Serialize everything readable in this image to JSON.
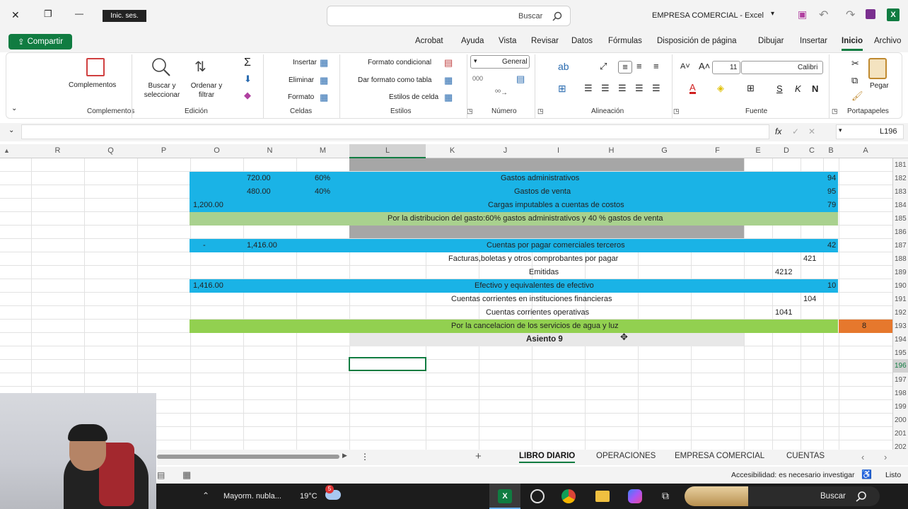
{
  "titlebar": {
    "title": "EMPRESA COMERCIAL  -  Excel",
    "search_placeholder": "Buscar",
    "signin": "Inic. ses.",
    "close": "✕",
    "restore": "❐",
    "minimize": "—"
  },
  "menu": [
    "Archivo",
    "Inicio",
    "Insertar",
    "Dibujar",
    "Disposición de página",
    "Fórmulas",
    "Datos",
    "Revisar",
    "Vista",
    "Ayuda",
    "Acrobat"
  ],
  "share_label": "Compartir",
  "ribbon": {
    "groups": {
      "portapapeles": "Portapapeles",
      "fuente": "Fuente",
      "alineacion": "Alineación",
      "numero": "Número",
      "estilos": "Estilos",
      "celdas": "Celdas",
      "edicion": "Edición",
      "complementos": "Complementos"
    },
    "pegar": "Pegar",
    "font_name": "Calibri",
    "font_size": "11",
    "number_format": "General",
    "formato_condicional": "Formato condicional",
    "dar_formato_tabla": "Dar formato como tabla",
    "estilos_celda": "Estilos de celda",
    "insertar": "Insertar",
    "eliminar": "Eliminar",
    "formato": "Formato",
    "ordenar": "Ordenar y filtrar",
    "buscar": "Buscar y seleccionar",
    "complementos_btn": "Complementos"
  },
  "formula_bar": {
    "name_box": "L196",
    "fx": "fx",
    "content": ""
  },
  "columns": [
    "A",
    "B",
    "C",
    "D",
    "E",
    "F",
    "G",
    "H",
    "I",
    "J",
    "K",
    "L",
    "M",
    "N",
    "O",
    "P",
    "Q",
    "R"
  ],
  "row_numbers": [
    "181",
    "182",
    "183",
    "184",
    "185",
    "186",
    "187",
    "188",
    "189",
    "190",
    "191",
    "192",
    "193",
    "194",
    "195",
    "196",
    "197",
    "198",
    "199",
    "200",
    "201",
    "202"
  ],
  "rows": {
    "r182": {
      "code": "94",
      "desc": "Gastos administrativos",
      "pct": "60%",
      "amount": "720.00"
    },
    "r183": {
      "code": "95",
      "desc": "Gastos de venta",
      "pct": "40%",
      "amount": "480.00"
    },
    "r184": {
      "code": "79",
      "desc": "Cargas imputables a cuentas de costos",
      "total": "1,200.00"
    },
    "r185": {
      "desc": "Por la distribucion del gasto:60% gastos administrativos y 40 % gastos de venta"
    },
    "r187": {
      "code": "42",
      "desc": "Cuentas por pagar comerciales terceros",
      "amount": "1,416.00",
      "dash": "-"
    },
    "r188": {
      "code": "421",
      "desc": "Facturas,boletas y otros comprobantes por pagar"
    },
    "r189": {
      "code": "4212",
      "desc": "Emitidas"
    },
    "r190": {
      "code": "10",
      "desc": "Efectivo y equivalentes de efectivo",
      "total": "1,416.00"
    },
    "r191": {
      "code": "104",
      "desc": "Cuentas corrientes en instituciones financieras"
    },
    "r192": {
      "code": "1041",
      "desc": "Cuentas corrientes operativas"
    },
    "r193": {
      "num": "8",
      "desc": "Por la cancelacion de los servicios de agua y luz"
    },
    "r194": {
      "desc": "Asiento 9"
    }
  },
  "sheets": [
    "CUENTAS",
    "EMPRESA COMERCIAL",
    "OPERACIONES",
    "LIBRO DIARIO"
  ],
  "active_sheet": "LIBRO DIARIO",
  "status": {
    "ready": "Listo",
    "accessibility": "Accesibilidad: es necesario investigar"
  },
  "taskbar": {
    "search": "Buscar",
    "weather_temp": "19°C",
    "weather_text": "Mayorm. nubla...",
    "badge": "5"
  },
  "colors": {
    "cyan": "#1ab3e6",
    "lightgreen": "#a9d18e",
    "green": "#92d050",
    "orange": "#e6782d",
    "gray": "#a6a6a6",
    "excel_green": "#107c41"
  }
}
